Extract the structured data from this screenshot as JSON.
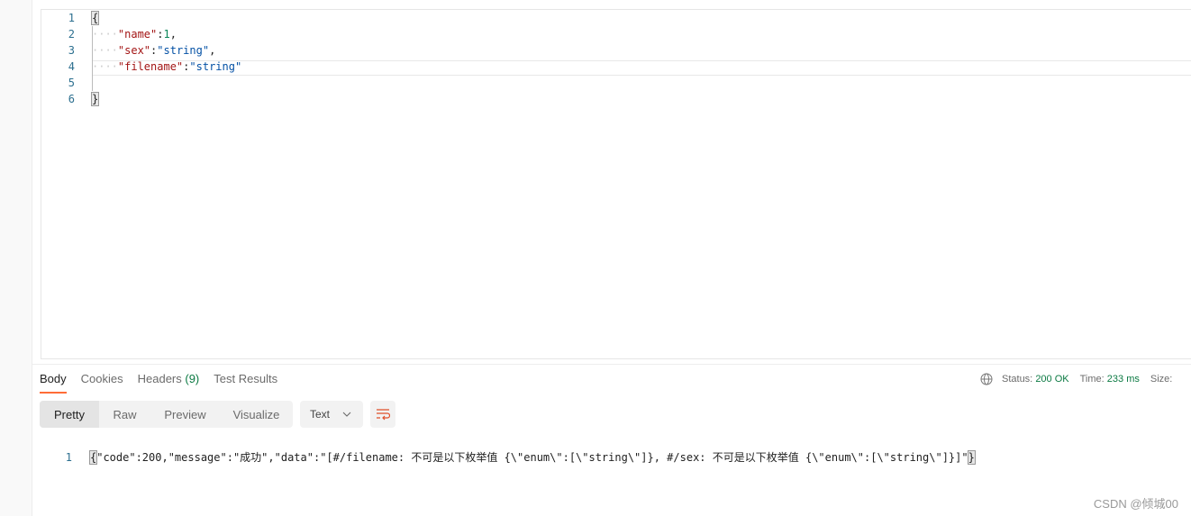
{
  "request_body": {
    "lines": [
      {
        "num": "1"
      },
      {
        "num": "2",
        "key": "\"name\"",
        "val": "1"
      },
      {
        "num": "3",
        "key": "\"sex\"",
        "val": "\"string\""
      },
      {
        "num": "4",
        "key": "\"filename\"",
        "val": "\"string\""
      },
      {
        "num": "5"
      },
      {
        "num": "6"
      }
    ],
    "open": "{",
    "close": "}"
  },
  "response": {
    "tabs": [
      {
        "label": "Body"
      },
      {
        "label": "Cookies"
      },
      {
        "label": "Headers",
        "count": "(9)"
      },
      {
        "label": "Test Results"
      }
    ],
    "status_label": "Status:",
    "status_value": "200 OK",
    "time_label": "Time:",
    "time_value": "233 ms",
    "size_label": "Size:",
    "views": [
      "Pretty",
      "Raw",
      "Preview",
      "Visualize"
    ],
    "format": "Text",
    "line_num": "1",
    "body": "\"code\":200,\"message\":\"成功\",\"data\":\"[#/filename: 不可是以下枚举值 {\\\"enum\\\":[\\\"string\\\"]}, #/sex: 不可是以下枚举值 {\\\"enum\\\":[\\\"string\\\"]}]\"",
    "accent": "#ff6c37"
  },
  "watermark": "CSDN @倾城00"
}
